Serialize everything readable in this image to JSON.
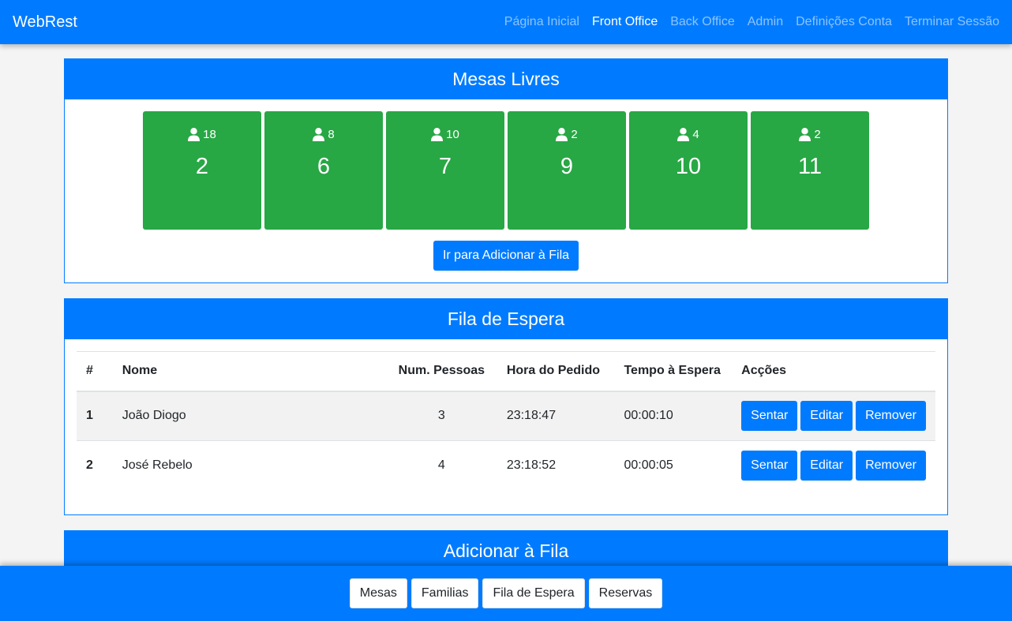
{
  "nav": {
    "brand": "WebRest",
    "links": [
      {
        "label": "Página Inicial",
        "active": false
      },
      {
        "label": "Front Office",
        "active": true
      },
      {
        "label": "Back Office",
        "active": false
      },
      {
        "label": "Admin",
        "active": false
      },
      {
        "label": "Definições Conta",
        "active": false
      },
      {
        "label": "Terminar Sessão",
        "active": false
      }
    ]
  },
  "mesas": {
    "title": "Mesas Livres",
    "tables": [
      {
        "capacity": "18",
        "number": "2"
      },
      {
        "capacity": "8",
        "number": "6"
      },
      {
        "capacity": "10",
        "number": "7"
      },
      {
        "capacity": "2",
        "number": "9"
      },
      {
        "capacity": "4",
        "number": "10"
      },
      {
        "capacity": "2",
        "number": "11"
      }
    ],
    "button": "Ir para Adicionar à Fila"
  },
  "fila": {
    "title": "Fila de Espera",
    "columns": [
      "#",
      "Nome",
      "Num. Pessoas",
      "Hora do Pedido",
      "Tempo à Espera",
      "Acções"
    ],
    "rows": [
      {
        "idx": "1",
        "name": "João Diogo",
        "people": "3",
        "time": "23:18:47",
        "wait": "00:00:10"
      },
      {
        "idx": "2",
        "name": "José Rebelo",
        "people": "4",
        "time": "23:18:52",
        "wait": "00:00:05"
      }
    ],
    "actions": {
      "seat": "Sentar",
      "edit": "Editar",
      "remove": "Remover"
    }
  },
  "add": {
    "title": "Adicionar à Fila"
  },
  "footer": {
    "buttons": [
      "Mesas",
      "Familias",
      "Fila de Espera",
      "Reservas"
    ]
  },
  "colors": {
    "primary": "#007bff",
    "success": "#28a745",
    "background": "#f4f4f4"
  }
}
